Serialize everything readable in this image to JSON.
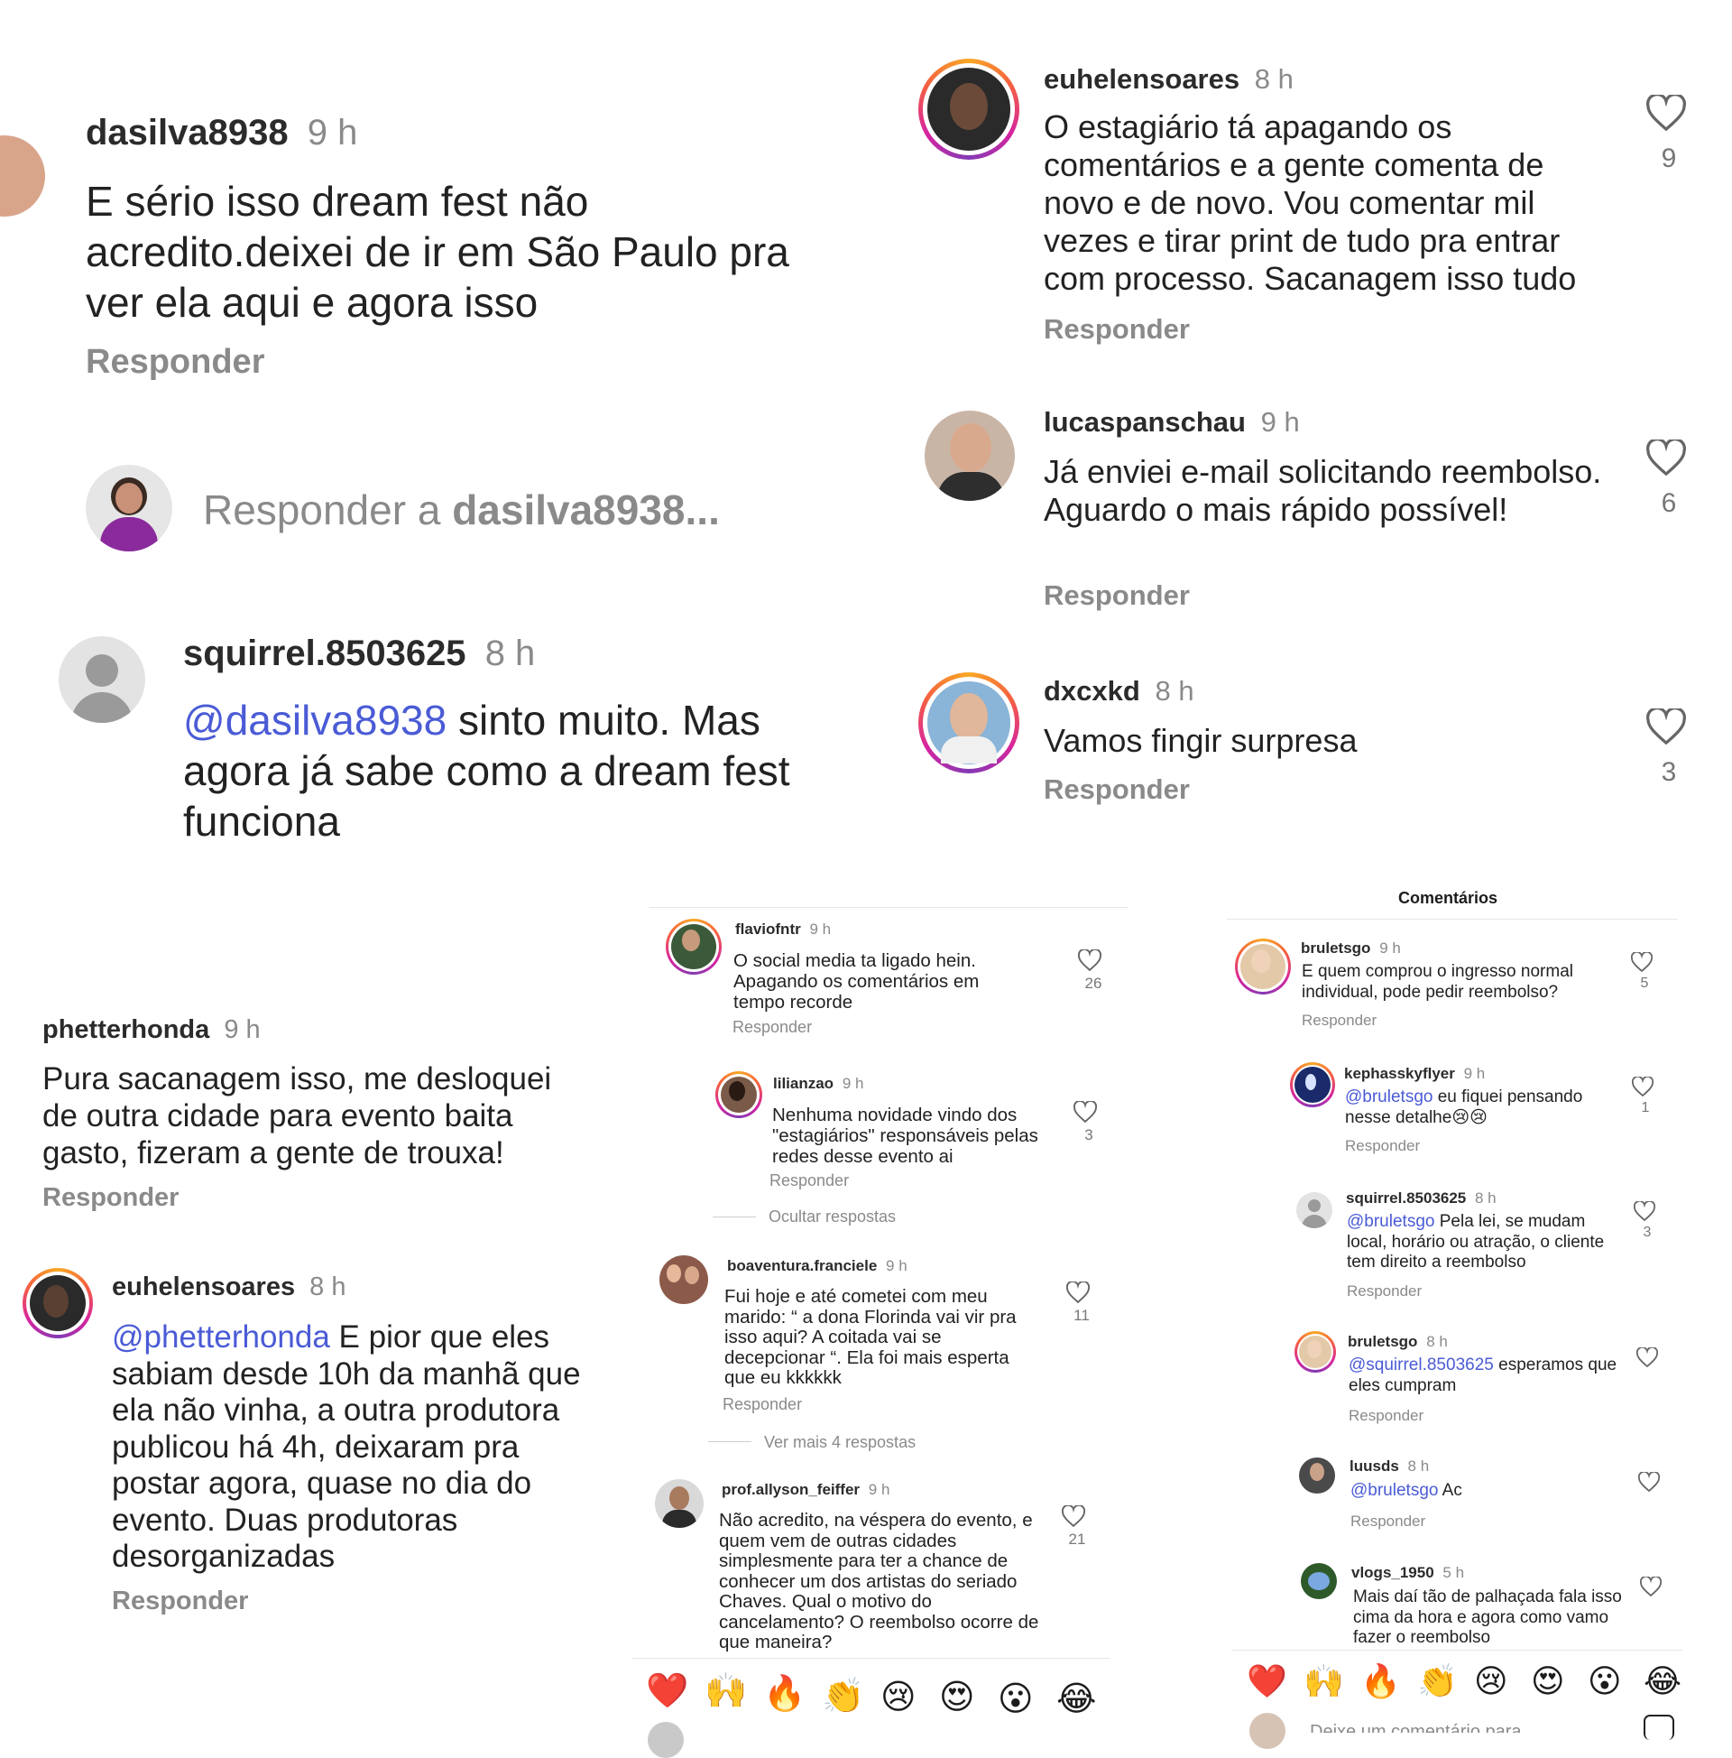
{
  "colors": {
    "mention": "#4a5bd6",
    "meta": "#8a8a8a",
    "text": "#222222"
  },
  "p1": {
    "comment": {
      "user": "dasilva8938",
      "time": "9 h",
      "text": "E sério isso dream fest não acredito.deixei de ir em São Paulo pra ver ela aqui e agora isso",
      "reply": "Responder"
    },
    "reply_box": {
      "prefix": "Responder a ",
      "user": "dasilva8938..."
    },
    "reply_comment": {
      "user": "squirrel.8503625",
      "time": "8 h",
      "mention": "@dasilva8938",
      "text": " sinto muito. Mas agora já sabe como a dream fest funciona"
    }
  },
  "p2": {
    "comments": [
      {
        "user": "euhelensoares",
        "time": "8 h",
        "text": "O estagiário tá apagando os comentários e a gente comenta de novo e de novo. Vou comentar mil vezes e tirar print de tudo pra entrar com processo. Sacanagem isso tudo",
        "reply": "Responder",
        "likes": "9"
      },
      {
        "user": "lucaspanschau",
        "time": "9 h",
        "text": "Já enviei e-mail solicitando reembolso. Aguardo o mais rápido possível!",
        "reply": "Responder",
        "likes": "6"
      },
      {
        "user": "dxcxkd",
        "time": "8 h",
        "text": "Vamos fingir surpresa",
        "reply": "Responder",
        "likes": "3"
      }
    ]
  },
  "p3": {
    "comment": {
      "user": "phetterhonda",
      "time": "9 h",
      "text": "Pura sacanagem isso, me desloquei de outra cidade para evento baita gasto, fizeram a gente de trouxa!",
      "reply": "Responder"
    },
    "reply_comment": {
      "user": "euhelensoares",
      "time": "8 h",
      "mention": "@phetterhonda",
      "text": " E pior que eles sabiam desde 10h da manhã que ela não vinha, a outra produtora publicou há 4h, deixaram pra postar agora, quase no dia do evento. Duas produtoras desorganizadas",
      "reply": "Responder"
    }
  },
  "p4": {
    "c1": {
      "user": "flaviofntr",
      "time": "9 h",
      "text": "O social media ta ligado hein. Apagando os comentários em tempo recorde",
      "reply": "Responder",
      "likes": "26"
    },
    "c2": {
      "user": "lilianzao",
      "time": "9 h",
      "text": "Nenhuma novidade vindo dos \"estagiários\" responsáveis pelas redes desse evento ai",
      "reply": "Responder",
      "likes": "3"
    },
    "hide": "Ocultar respostas",
    "c3": {
      "user": "boaventura.franciele",
      "time": "9 h",
      "text": "Fui hoje e até cometei com meu marido: “ a dona Florinda vai vir pra isso aqui? A coitada vai se decepcionar “. Ela foi mais esperta que eu kkkkkk",
      "reply": "Responder",
      "likes": "11"
    },
    "more": "Ver mais 4 respostas",
    "c4": {
      "user": "prof.allyson_feiffer",
      "time": "9 h",
      "text": "Não acredito, na véspera do evento, e quem vem de outras cidades simplesmente para ter a chance de conhecer um dos artistas do seriado Chaves. Qual o motivo do cancelamento? O reembolso ocorre de que maneira?",
      "likes": "21"
    },
    "emojis": [
      "❤️",
      "🙌",
      "🔥",
      "👏",
      "😢",
      "😍",
      "😮",
      "😂"
    ]
  },
  "p5": {
    "title": "Comentários",
    "c1": {
      "user": "bruletsgo",
      "time": "9 h",
      "text": "E quem comprou o ingresso normal individual, pode pedir reembolso?",
      "reply": "Responder",
      "likes": "5"
    },
    "c2": {
      "user": "kephasskyflyer",
      "time": "9 h",
      "mention": "@bruletsgo",
      "text": " eu fiquei pensando nesse detalhe😢😢",
      "reply": "Responder",
      "likes": "1"
    },
    "c3": {
      "user": "squirrel.8503625",
      "time": "8 h",
      "mention": "@bruletsgo",
      "text": " Pela lei, se mudam local, horário ou atração, o cliente tem direito a reembolso",
      "reply": "Responder",
      "likes": "3"
    },
    "c4": {
      "user": "bruletsgo",
      "time": "8 h",
      "mention": "@squirrel.8503625",
      "text": " esperamos que eles cumpram",
      "reply": "Responder"
    },
    "c5": {
      "user": "luusds",
      "time": "8 h",
      "mention": "@bruletsgo",
      "text": " Ac",
      "reply": "Responder"
    },
    "c6": {
      "user": "vlogs_1950",
      "time": "5 h",
      "text": "Mais daí tão de palhaçada fala isso cima da hora e agora como vamo fazer o reembolso"
    },
    "emojis": [
      "❤️",
      "🙌",
      "🔥",
      "👏",
      "😢",
      "😍",
      "😮",
      "😂"
    ],
    "input_placeholder": "Deixe um comentário para dreamfestc..."
  }
}
